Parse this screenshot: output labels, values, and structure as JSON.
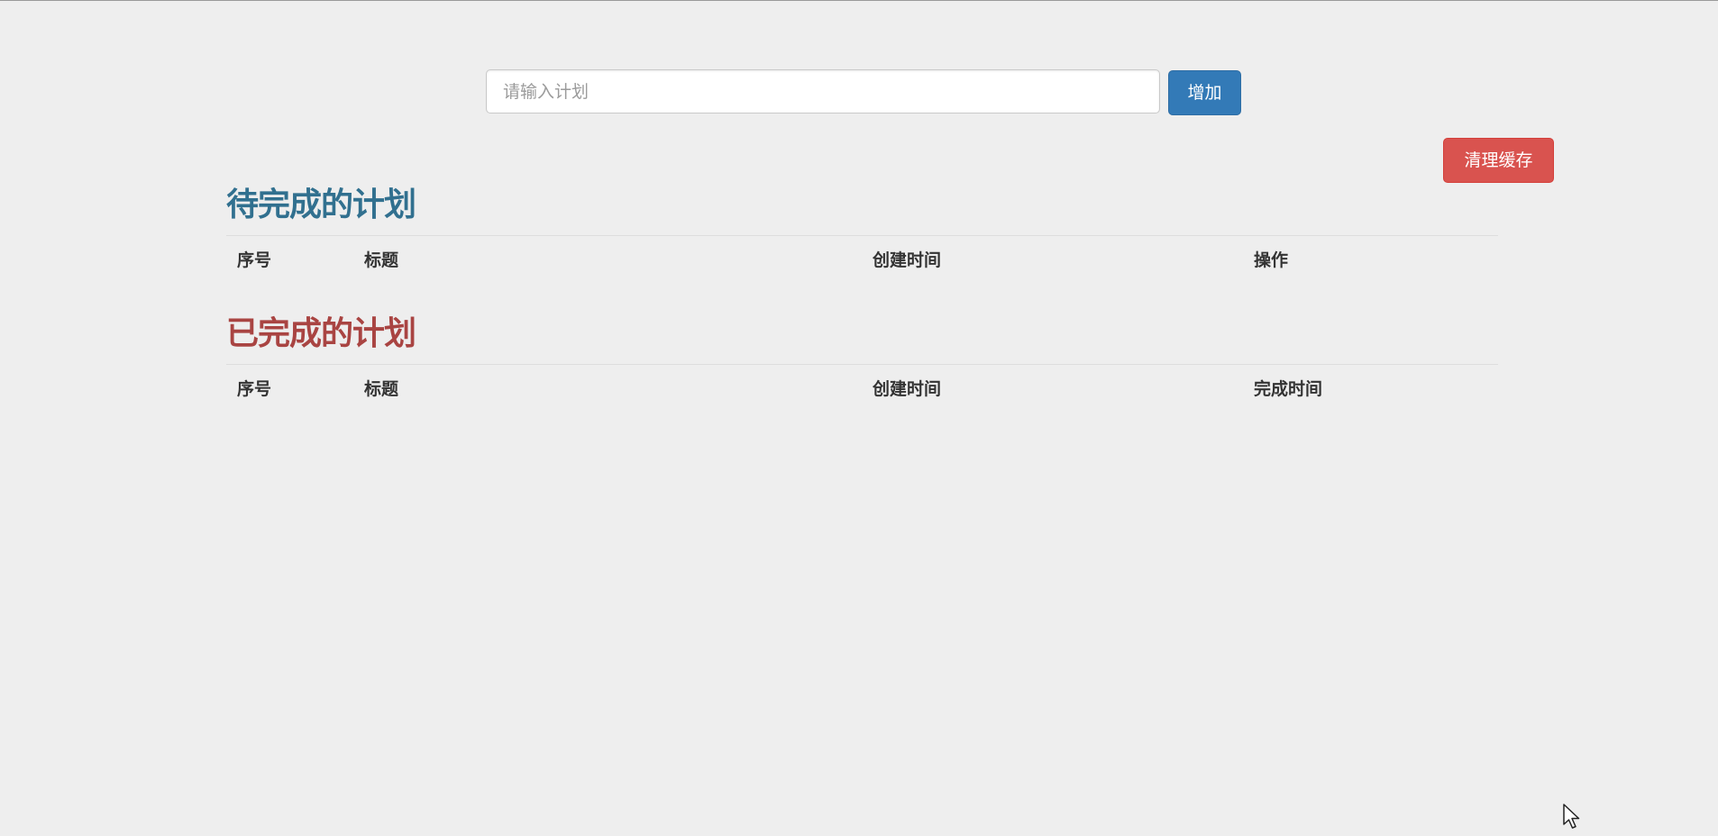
{
  "input": {
    "placeholder": "请输入计划",
    "value": ""
  },
  "buttons": {
    "add_label": "增加",
    "clear_label": "清理缓存"
  },
  "todo_section": {
    "title": "待完成的计划",
    "columns": [
      "序号",
      "标题",
      "创建时间",
      "操作"
    ],
    "rows": []
  },
  "done_section": {
    "title": "已完成的计划",
    "columns": [
      "序号",
      "标题",
      "创建时间",
      "完成时间"
    ],
    "rows": []
  },
  "colors": {
    "page_background": "#eeeeee",
    "todo_title": "#31708f",
    "done_title": "#a94442",
    "add_button": "#337ab7",
    "clear_button": "#d9534f"
  },
  "icons": {
    "cursor": "mouse-pointer-icon"
  }
}
